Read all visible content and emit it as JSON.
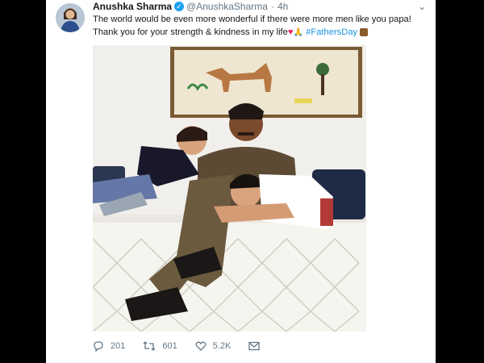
{
  "tweet": {
    "author_name": "Anushka Sharma",
    "handle": "@AnushkaSharma",
    "separator": "·",
    "time": "4h",
    "text_line1": "The world would be even more wonderful if there were more men like you papa!",
    "text_line2_prefix": "Thank you for your strength & kindness in my life",
    "hashtag": "#FathersDay",
    "emojis": [
      "red-heart",
      "folded-hands",
      "beer-mug"
    ]
  },
  "actions": {
    "replies": "201",
    "retweets": "601",
    "likes": "5.2K"
  },
  "colors": {
    "link": "#1b95e0",
    "verified": "#1da1f2",
    "muted": "#657786",
    "text": "#14171a"
  }
}
